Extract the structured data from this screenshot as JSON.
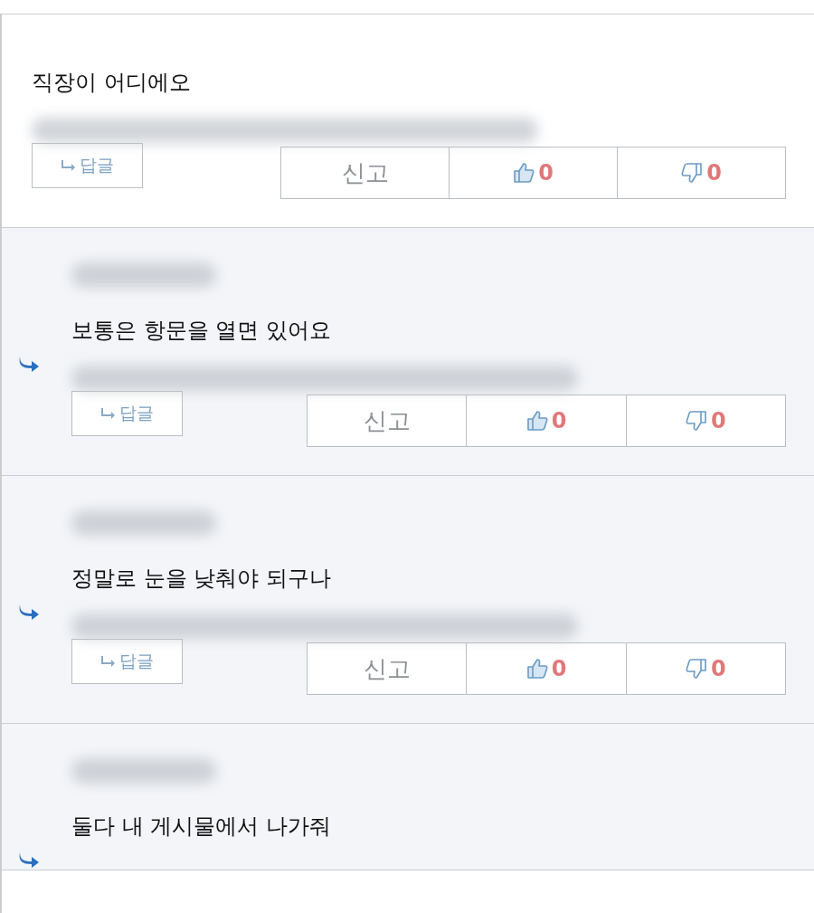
{
  "comments": [
    {
      "kind": "comment",
      "text": "직장이 어디에오",
      "actions": {
        "reply": "답글",
        "report": "신고",
        "likes": "0",
        "dislikes": "0"
      }
    },
    {
      "kind": "reply",
      "text": "보통은 항문을 열면 있어요",
      "actions": {
        "reply": "답글",
        "report": "신고",
        "likes": "0",
        "dislikes": "0"
      }
    },
    {
      "kind": "reply",
      "text": "정말로 눈을 낮춰야 되구나",
      "actions": {
        "reply": "답글",
        "report": "신고",
        "likes": "0",
        "dislikes": "0"
      }
    },
    {
      "kind": "reply",
      "text": "둘다 내 게시물에서 나가줘"
    }
  ]
}
